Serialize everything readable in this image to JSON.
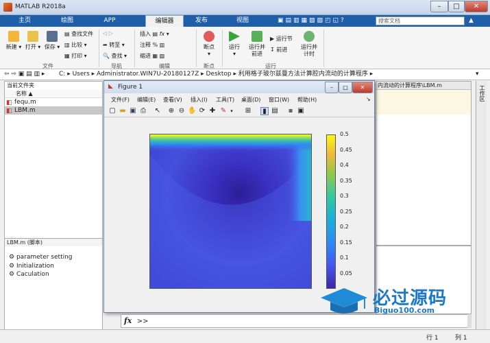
{
  "window": {
    "title": "MATLAB R2018a"
  },
  "tabs": [
    "主页",
    "绘图",
    "APP",
    "编辑器",
    "发布",
    "视图"
  ],
  "active_tab": "编辑器",
  "search": {
    "placeholder": "搜索文档"
  },
  "ribbon": {
    "new": "新建",
    "open": "打开",
    "save": "保存",
    "file_group": "文件",
    "find_files": "查找文件",
    "compare": "比较",
    "print": "打印",
    "goto": "转至",
    "find": "查找",
    "nav_group": "导航",
    "insert": "插入",
    "comment": "注释",
    "indent": "缩进",
    "fx": "fx",
    "edit_group": "编辑",
    "breakpoints": "断点",
    "bp_group": "断点",
    "run": "运行",
    "run_advance": "运行并\n前进",
    "run_section": "运行节",
    "advance": "前进",
    "run_time": "运行并\n计时",
    "run_group": "运行"
  },
  "address": {
    "path": [
      "C:",
      "Users",
      "Administrator.WIN7U-20180127Z",
      "Desktop",
      "利用格子玻尔兹曼方法计算腔内流动的计算程序"
    ]
  },
  "current_folder": {
    "title": "当前文件夹",
    "col": "名称 ▲",
    "files": [
      "fequ.m",
      "LBM.m"
    ],
    "selected": "LBM.m"
  },
  "details": {
    "title": "LBM.m  (脚本)",
    "items": [
      "parameter setting",
      "Initialization",
      "Caculation"
    ]
  },
  "editor_tab": "内流动的计算程序\\LBM.m",
  "workspace_label": "工作区",
  "figure": {
    "title": "Figure 1",
    "menu": [
      "文件(F)",
      "编辑(E)",
      "查看(V)",
      "插入(I)",
      "工具(T)",
      "桌面(D)",
      "窗口(W)",
      "帮助(H)"
    ]
  },
  "chart_data": {
    "type": "heatmap",
    "colorbar": {
      "ticks": [
        "0.05",
        "0.1",
        "0.15",
        "0.2",
        "0.25",
        "0.3",
        "0.35",
        "0.4",
        "0.45",
        "0.5"
      ],
      "range": [
        0,
        0.5
      ],
      "colormap": "parula"
    }
  },
  "command": {
    "prompt": ">>",
    "fx": "fx"
  },
  "status": {
    "row_label": "行",
    "row": "1",
    "col_label": "列",
    "col": "1"
  },
  "watermark": {
    "title": "必过源码",
    "url": "Biguo100.com"
  }
}
